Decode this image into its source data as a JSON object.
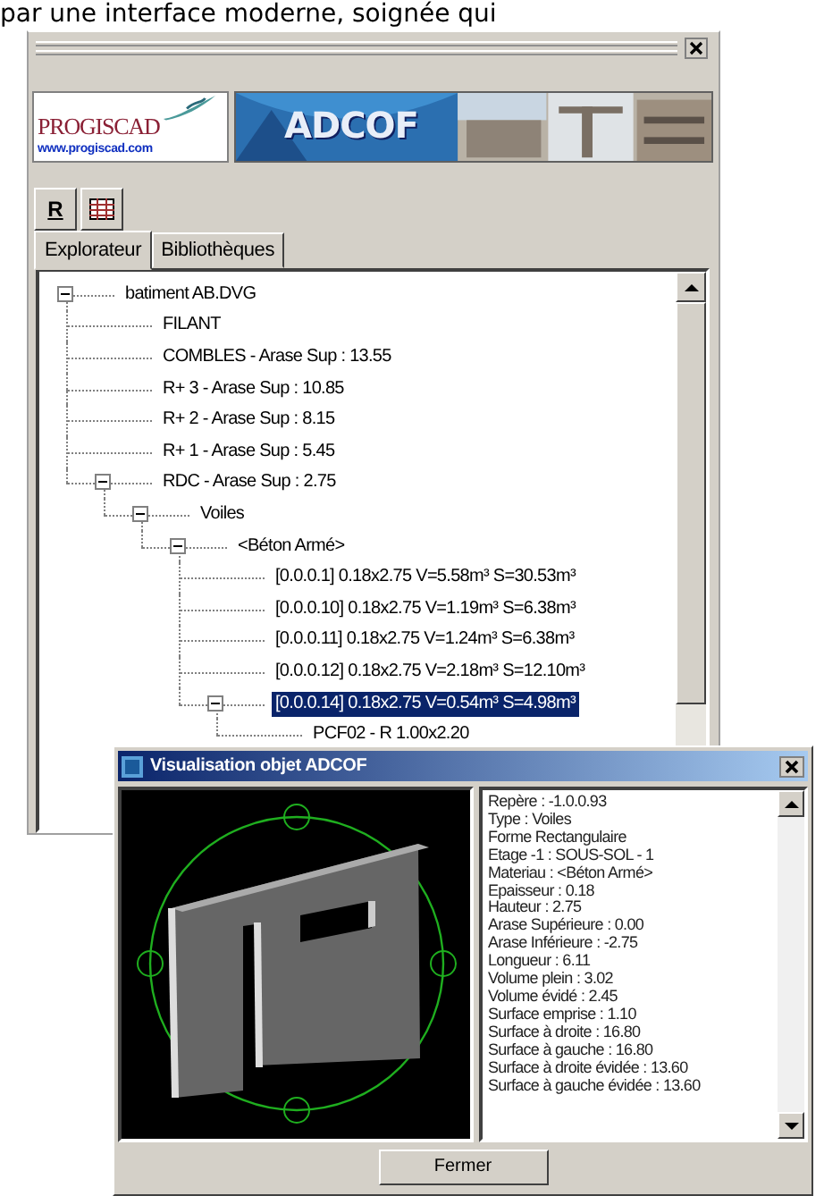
{
  "caption": "par une interface moderne, soignée qui",
  "panel": {
    "logo": {
      "name": "PROGISCAD",
      "url": "www.progiscad.com"
    },
    "banner": {
      "title": "ADCOF",
      "kind": "picture"
    },
    "toolbar": [
      {
        "kind": "letter",
        "label": "R"
      },
      {
        "kind": "grid"
      }
    ],
    "tabs": [
      {
        "label": "Explorateur",
        "selected": true
      },
      {
        "label": "Bibliothèques",
        "selected": false
      }
    ],
    "tree": [
      {
        "label": "batiment AB.DVG",
        "expanded": true,
        "selected": false,
        "children": [
          {
            "label": "FILANT",
            "selected": false
          },
          {
            "label": "COMBLES - Arase Sup : 13.55",
            "selected": false
          },
          {
            "label": "R+ 3 - Arase Sup : 10.85",
            "selected": false
          },
          {
            "label": "R+ 2 - Arase Sup : 8.15",
            "selected": false
          },
          {
            "label": "R+ 1 - Arase Sup : 5.45",
            "selected": false
          },
          {
            "label": "RDC - Arase Sup : 2.75",
            "expanded": true,
            "selected": false,
            "children": [
              {
                "label": "Voiles",
                "expanded": true,
                "selected": false,
                "children": [
                  {
                    "label": "<Béton Armé>",
                    "expanded": true,
                    "selected": false,
                    "children": [
                      {
                        "label": "[0.0.0.1] 0.18x2.75 V=5.58m³ S=30.53m³",
                        "selected": false
                      },
                      {
                        "label": "[0.0.0.10] 0.18x2.75 V=1.19m³ S=6.38m³",
                        "selected": false
                      },
                      {
                        "label": "[0.0.0.11] 0.18x2.75 V=1.24m³ S=6.38m³",
                        "selected": false
                      },
                      {
                        "label": "[0.0.0.12] 0.18x2.75 V=2.18m³ S=12.10m³",
                        "selected": false
                      },
                      {
                        "label": "[0.0.0.14] 0.18x2.75 V=0.54m³ S=4.98m³",
                        "expanded": true,
                        "selected": true,
                        "children": [
                          {
                            "label": "PCF02 - R 1.00x2.20",
                            "selected": false
                          }
                        ]
                      }
                    ]
                  }
                ]
              }
            ]
          }
        ]
      }
    ]
  },
  "dialog": {
    "title": "Visualisation objet ADCOF",
    "properties": [
      "Repère : -1.0.0.93",
      "Type : Voiles",
      "Forme Rectangulaire",
      "Etage -1 : SOUS-SOL - 1",
      "Materiau : <Béton Armé>",
      "Epaisseur : 0.18",
      "Hauteur : 2.75",
      "Arase Supérieure : 0.00",
      "Arase Inférieure : -2.75",
      "Longueur : 6.11",
      "Volume plein : 3.02",
      "Volume évidé : 2.45",
      "Surface emprise : 1.10",
      "Surface à droite : 16.80",
      "Surface à gauche : 16.80",
      "Surface à droite évidée : 13.60",
      "Surface à gauche évidée : 13.60"
    ],
    "buttons": [
      "Fermer"
    ]
  }
}
